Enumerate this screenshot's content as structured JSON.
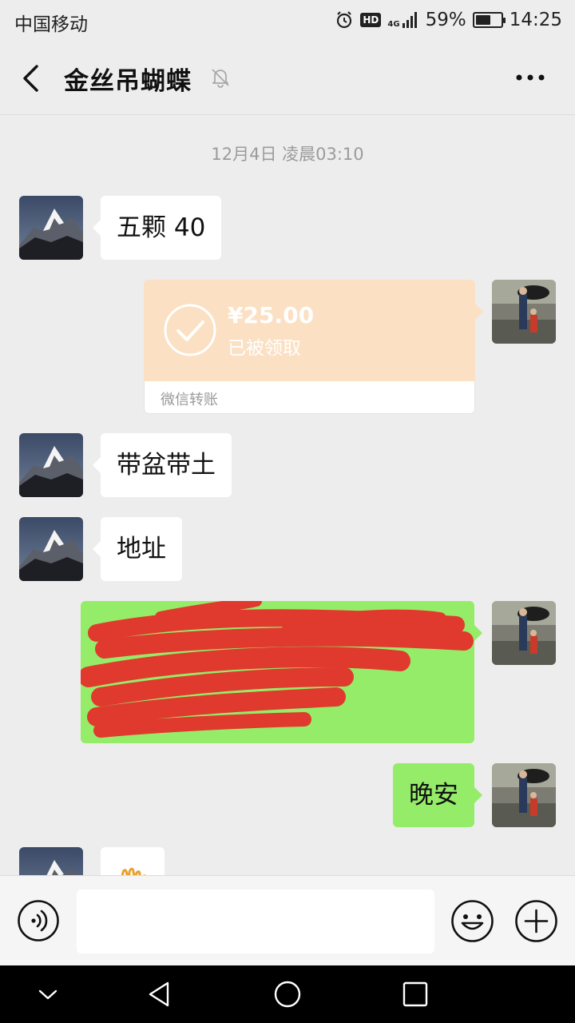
{
  "status_bar": {
    "carrier": "中国移动",
    "hd": "HD",
    "network": "4G",
    "battery_percent": "59%",
    "battery_level": 0.59,
    "time": "14:25"
  },
  "header": {
    "title": "金丝吊蝴蝶",
    "back_icon": "chevron-left-icon",
    "mute_icon": "bell-off-icon",
    "more_icon": "more-horizontal-icon"
  },
  "chat": {
    "timestamp": "12月4日 凌晨03:10",
    "messages": [
      {
        "side": "left",
        "type": "text",
        "text": "五颗 40"
      },
      {
        "side": "right",
        "type": "transfer",
        "amount": "¥25.00",
        "status": "已被领取",
        "label": "微信转账"
      },
      {
        "side": "left",
        "type": "text",
        "text": "带盆带土"
      },
      {
        "side": "left",
        "type": "text",
        "text": "地址"
      },
      {
        "side": "right",
        "type": "redacted",
        "text": ""
      },
      {
        "side": "right",
        "type": "text",
        "text": "晚安"
      },
      {
        "side": "left",
        "type": "sticker",
        "text": ""
      }
    ]
  },
  "input_bar": {
    "placeholder": "",
    "voice_icon": "voice-icon",
    "emoji_icon": "emoji-icon",
    "plus_icon": "plus-icon"
  },
  "nav_bar": {
    "icons": [
      "nav-collapse-icon",
      "nav-back-icon",
      "nav-home-icon",
      "nav-recents-icon"
    ]
  },
  "colors": {
    "background": "#ededed",
    "bubble_sent": "#95ec69",
    "bubble_received": "#ffffff",
    "transfer": "#fbe0c3",
    "redaction": "#e03a2e"
  }
}
